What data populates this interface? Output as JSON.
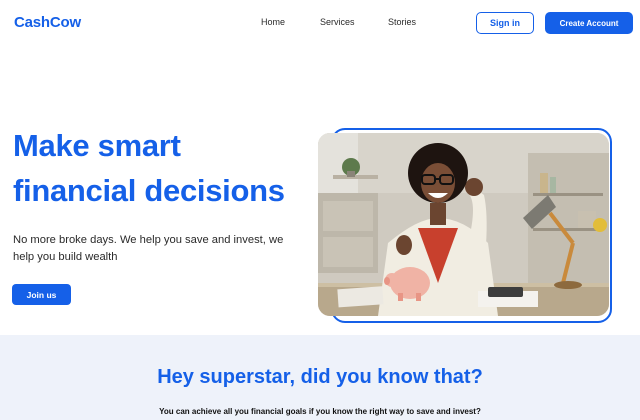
{
  "header": {
    "logo": "CashCow",
    "nav": [
      "Home",
      "Services",
      "Stories"
    ],
    "signin_label": "Sign in",
    "create_label": "Create Account"
  },
  "hero": {
    "title_line1": "Make smart",
    "title_line2": "financial decisions",
    "subtitle": "No more broke days. We help you save and invest, we help you build wealth",
    "cta_label": "Join us"
  },
  "info": {
    "title": "Hey superstar, did you know that?",
    "text": "You can achieve all you financial goals if you know the right way to save and invest?"
  },
  "colors": {
    "brand": "#1560e8",
    "section_bg": "#eef2fa"
  }
}
